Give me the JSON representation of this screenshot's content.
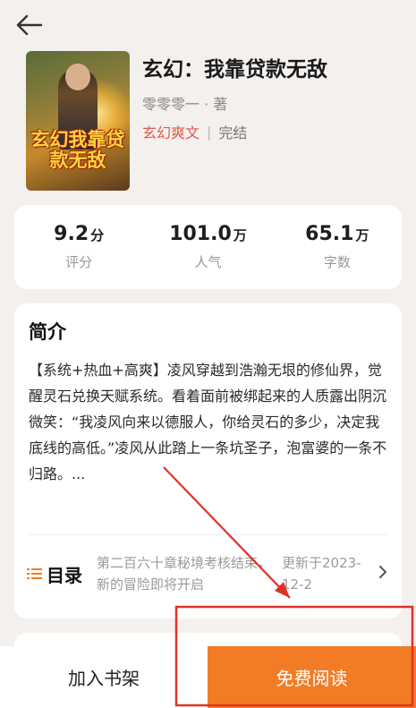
{
  "header": {
    "back_icon": "arrow-left-icon"
  },
  "book": {
    "title": "玄幻：我靠贷款无敌",
    "author": "零零零一 · 著",
    "genre": "玄幻爽文",
    "separator": "|",
    "status": "完结",
    "cover_text": "玄幻我靠贷款无敌"
  },
  "stats": [
    {
      "value": "9.2",
      "unit": "分",
      "label": "评分"
    },
    {
      "value": "101.0",
      "unit": "万",
      "label": "人气"
    },
    {
      "value": "65.1",
      "unit": "万",
      "label": "字数"
    }
  ],
  "intro": {
    "heading": "简介",
    "text": "【系统+热血+高爽】凌风穿越到浩瀚无垠的修仙界，觉醒灵石兑换天赋系统。看着面前被绑起来的人质露出阴沉微笑：“我凌风向来以德服人，你给灵石的多少，决定我底线的高低。”凌风从此踏上一条坑圣子，泡富婆的一条不归路。..."
  },
  "catalog": {
    "icon": "list-icon",
    "label": "目录",
    "latest_chapter": "第二百六十章秘境考核结束，新的冒险即将开启",
    "updated": "更新于2023-12-2",
    "chevron": "chevron-right-icon"
  },
  "actions": {
    "add_shelf": "加入书架",
    "read_free": "免费阅读"
  },
  "colors": {
    "accent": "#f27c25",
    "genre": "#e05a4a",
    "annotation": "#e0312a"
  }
}
